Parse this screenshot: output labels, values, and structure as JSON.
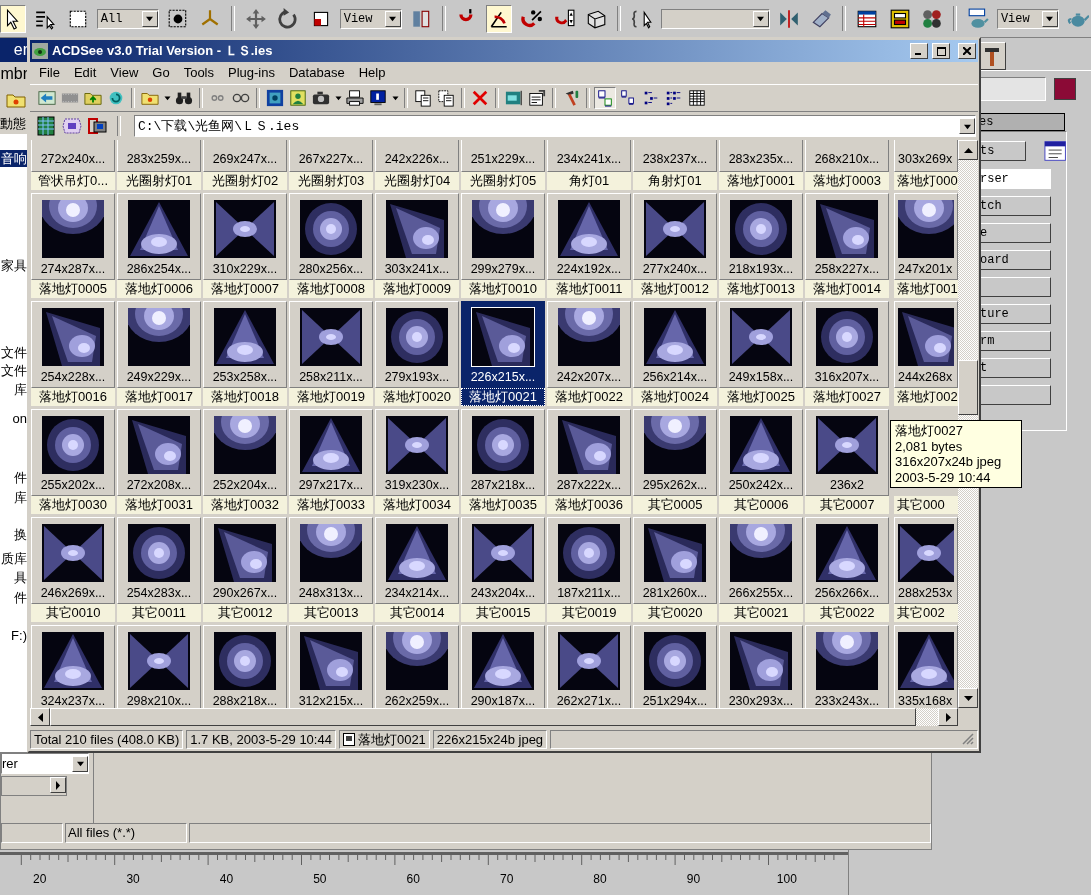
{
  "main_toolbar": {
    "items": [
      {
        "kind": "icon",
        "pressed": true
      },
      {
        "kind": "icon",
        "pressed": false
      },
      {
        "kind": "icon",
        "pressed": false
      },
      {
        "kind": "dropdown",
        "value": "All"
      },
      {
        "kind": "icon",
        "pressed": false
      },
      {
        "kind": "icon",
        "pressed": false
      },
      {
        "kind": "separator"
      },
      {
        "kind": "icon",
        "pressed": false
      },
      {
        "kind": "icon",
        "pressed": false
      },
      {
        "kind": "icon",
        "pressed": false
      },
      {
        "kind": "dropdown",
        "value": "View"
      },
      {
        "kind": "icon",
        "pressed": false
      },
      {
        "kind": "separator"
      },
      {
        "kind": "icon",
        "pressed": false
      },
      {
        "kind": "icon",
        "pressed": true
      },
      {
        "kind": "icon",
        "pressed": false
      },
      {
        "kind": "icon",
        "pressed": false
      },
      {
        "kind": "icon",
        "pressed": false
      },
      {
        "kind": "separator"
      },
      {
        "kind": "icon",
        "pressed": false
      },
      {
        "kind": "dropdown"
      },
      {
        "kind": "icon",
        "pressed": false
      },
      {
        "kind": "icon",
        "pressed": false
      },
      {
        "kind": "separator"
      },
      {
        "kind": "icon",
        "pressed": false
      },
      {
        "kind": "icon",
        "pressed": false
      },
      {
        "kind": "icon",
        "pressed": false
      },
      {
        "kind": "separator"
      },
      {
        "kind": "icon",
        "pressed": false
      },
      {
        "kind": "dropdown",
        "value": "View"
      },
      {
        "kind": "icon",
        "pressed": false
      }
    ]
  },
  "explorer": {
    "title": "er",
    "menu_text": "mbr",
    "toolbar_text": "動態",
    "tree": [
      {
        "label": "音响",
        "selected": true
      },
      {
        "label": "家具",
        "selected": false
      },
      {
        "label": "文件",
        "selected": false
      },
      {
        "label": "文件",
        "selected": false
      },
      {
        "label": "库",
        "selected": false
      },
      {
        "label": "on",
        "selected": false
      },
      {
        "label": "件",
        "selected": false
      },
      {
        "label": "库",
        "selected": false
      },
      {
        "label": "换",
        "selected": false
      },
      {
        "label": "质库",
        "selected": false
      },
      {
        "label": "具",
        "selected": false
      },
      {
        "label": "件",
        "selected": false
      },
      {
        "label": "F:)",
        "selected": false
      }
    ]
  },
  "command_panel": {
    "rollout_title": "es",
    "top_button": "ts",
    "buttons": [
      {
        "label": "rser",
        "selected": true
      },
      {
        "label": "tch",
        "selected": false
      },
      {
        "label": "e",
        "selected": false
      },
      {
        "label": "oard",
        "selected": false
      },
      {
        "selected": false
      },
      {
        "label": "ture",
        "selected": false
      },
      {
        "label": "rm",
        "selected": false
      },
      {
        "label": "t",
        "selected": false
      },
      {
        "selected": false
      }
    ]
  },
  "dialog": {
    "field_value": "rer",
    "status": "All files (*.*)"
  },
  "ruler": {
    "labels": [
      "20",
      "30",
      "40",
      "50",
      "60",
      "70",
      "80",
      "90",
      "100"
    ]
  },
  "window": {
    "title": "ACDSee v3.0 Trial Version - ＬＳ.ies",
    "menu": [
      "File",
      "Edit",
      "View",
      "Go",
      "Tools",
      "Plug-ins",
      "Database",
      "Help"
    ],
    "toolbar": [
      {
        "kind": "icon",
        "pressed": false
      },
      {
        "kind": "icon",
        "pressed": false
      },
      {
        "kind": "icon",
        "pressed": false
      },
      {
        "kind": "icon",
        "pressed": false
      },
      {
        "kind": "separator"
      },
      {
        "kind": "icon",
        "pressed": false
      },
      {
        "kind": "caret"
      },
      {
        "kind": "icon",
        "pressed": false
      },
      {
        "kind": "separator"
      },
      {
        "kind": "icon",
        "pressed": false
      },
      {
        "kind": "icon",
        "pressed": false
      },
      {
        "kind": "separator"
      },
      {
        "kind": "icon",
        "pressed": false
      },
      {
        "kind": "icon",
        "pressed": false
      },
      {
        "kind": "icon",
        "pressed": false
      },
      {
        "kind": "caret"
      },
      {
        "kind": "icon",
        "pressed": false
      },
      {
        "kind": "icon",
        "pressed": false
      },
      {
        "kind": "caret"
      },
      {
        "kind": "separator"
      },
      {
        "kind": "icon",
        "pressed": false
      },
      {
        "kind": "icon",
        "pressed": false
      },
      {
        "kind": "separator"
      },
      {
        "kind": "icon",
        "pressed": false
      },
      {
        "kind": "separator"
      },
      {
        "kind": "icon",
        "pressed": false
      },
      {
        "kind": "icon",
        "pressed": false
      },
      {
        "kind": "separator"
      },
      {
        "kind": "icon",
        "pressed": false
      },
      {
        "kind": "separator"
      },
      {
        "kind": "icon",
        "pressed": true
      },
      {
        "kind": "icon",
        "pressed": false
      },
      {
        "kind": "icon",
        "pressed": false
      },
      {
        "kind": "icon",
        "pressed": false
      },
      {
        "kind": "icon",
        "pressed": false
      }
    ],
    "address": "C:\\下载\\光鱼网\\ＬＳ.ies",
    "grid": {
      "rows": [
        {
          "kind": "cut-top",
          "cells": [
            {
              "dims": "272x240x...",
              "label": "管状吊灯0...",
              "selected": false
            },
            {
              "dims": "283x259x...",
              "label": "光圈射灯01",
              "selected": false
            },
            {
              "dims": "269x247x...",
              "label": "光圈射灯02",
              "selected": false
            },
            {
              "dims": "267x227x...",
              "label": "光圈射灯03",
              "selected": false
            },
            {
              "dims": "242x226x...",
              "label": "光圈射灯04",
              "selected": false
            },
            {
              "dims": "251x229x...",
              "label": "光圈射灯05",
              "selected": false
            },
            {
              "dims": "234x241x...",
              "label": "角灯01",
              "selected": false
            },
            {
              "dims": "238x237x...",
              "label": "角射灯01",
              "selected": false
            },
            {
              "dims": "283x235x...",
              "label": "落地灯0001",
              "selected": false
            },
            {
              "dims": "268x210x...",
              "label": "落地灯0003",
              "selected": false
            },
            {
              "dims": "303x269x",
              "label": "落地灯000",
              "selected": false
            }
          ]
        },
        {
          "kind": "full",
          "cells": [
            {
              "dims": "274x287x...",
              "label": "落地灯0005",
              "selected": false
            },
            {
              "dims": "286x254x...",
              "label": "落地灯0006",
              "selected": false
            },
            {
              "dims": "310x229x...",
              "label": "落地灯0007",
              "selected": false
            },
            {
              "dims": "280x256x...",
              "label": "落地灯0008",
              "selected": false
            },
            {
              "dims": "303x241x...",
              "label": "落地灯0009",
              "selected": false
            },
            {
              "dims": "299x279x...",
              "label": "落地灯0010",
              "selected": false
            },
            {
              "dims": "224x192x...",
              "label": "落地灯0011",
              "selected": false
            },
            {
              "dims": "277x240x...",
              "label": "落地灯0012",
              "selected": false
            },
            {
              "dims": "218x193x...",
              "label": "落地灯0013",
              "selected": false
            },
            {
              "dims": "258x227x...",
              "label": "落地灯0014",
              "selected": false
            },
            {
              "dims": "247x201x",
              "label": "落地灯001",
              "selected": false
            }
          ]
        },
        {
          "kind": "full",
          "cells": [
            {
              "dims": "254x228x...",
              "label": "落地灯0016",
              "selected": false
            },
            {
              "dims": "249x229x...",
              "label": "落地灯0017",
              "selected": false
            },
            {
              "dims": "253x258x...",
              "label": "落地灯0018",
              "selected": false
            },
            {
              "dims": "258x211x...",
              "label": "落地灯0019",
              "selected": false
            },
            {
              "dims": "279x193x...",
              "label": "落地灯0020",
              "selected": false
            },
            {
              "dims": "226x215x...",
              "label": "落地灯0021",
              "selected": true
            },
            {
              "dims": "242x207x...",
              "label": "落地灯0022",
              "selected": false
            },
            {
              "dims": "256x214x...",
              "label": "落地灯0024",
              "selected": false
            },
            {
              "dims": "249x158x...",
              "label": "落地灯0025",
              "selected": false
            },
            {
              "dims": "316x207x...",
              "label": "落地灯0027",
              "selected": false
            },
            {
              "dims": "244x268x",
              "label": "落地灯002",
              "selected": false
            }
          ]
        },
        {
          "kind": "full",
          "cells": [
            {
              "dims": "255x202x...",
              "label": "落地灯0030",
              "selected": false
            },
            {
              "dims": "272x208x...",
              "label": "落地灯0031",
              "selected": false
            },
            {
              "dims": "252x204x...",
              "label": "落地灯0032",
              "selected": false
            },
            {
              "dims": "297x217x...",
              "label": "落地灯0033",
              "selected": false
            },
            {
              "dims": "319x230x...",
              "label": "落地灯0034",
              "selected": false
            },
            {
              "dims": "287x218x...",
              "label": "落地灯0035",
              "selected": false
            },
            {
              "dims": "287x222x...",
              "label": "落地灯0036",
              "selected": false
            },
            {
              "dims": "295x262x...",
              "label": "其它0005",
              "selected": false
            },
            {
              "dims": "250x242x...",
              "label": "其它0006",
              "selected": false
            },
            {
              "dims": "236x2",
              "label": "其它0007",
              "selected": false
            },
            {
              "kind": "covered",
              "label": "其它000",
              "selected": false
            }
          ]
        },
        {
          "kind": "full",
          "cells": [
            {
              "dims": "246x269x...",
              "label": "其它0010",
              "selected": false
            },
            {
              "dims": "254x283x...",
              "label": "其它0011",
              "selected": false
            },
            {
              "dims": "290x267x...",
              "label": "其它0012",
              "selected": false
            },
            {
              "dims": "248x313x...",
              "label": "其它0013",
              "selected": false
            },
            {
              "dims": "234x214x...",
              "label": "其它0014",
              "selected": false
            },
            {
              "dims": "243x204x...",
              "label": "其它0015",
              "selected": false
            },
            {
              "dims": "187x211x...",
              "label": "其它0019",
              "selected": false
            },
            {
              "dims": "281x260x...",
              "label": "其它0020",
              "selected": false
            },
            {
              "dims": "266x255x...",
              "label": "其它0021",
              "selected": false
            },
            {
              "dims": "256x266x...",
              "label": "其它0022",
              "selected": false
            },
            {
              "dims": "288x253x",
              "label": "其它002",
              "selected": false
            }
          ]
        },
        {
          "kind": "cut-bottom",
          "cells": [
            {
              "dims": "324x237x...",
              "selected": false
            },
            {
              "dims": "298x210x...",
              "selected": false
            },
            {
              "dims": "288x218x...",
              "selected": false
            },
            {
              "dims": "312x215x...",
              "selected": false
            },
            {
              "dims": "262x259x...",
              "selected": false
            },
            {
              "dims": "290x187x...",
              "selected": false
            },
            {
              "dims": "262x271x...",
              "selected": false
            },
            {
              "dims": "251x294x...",
              "selected": false
            },
            {
              "dims": "230x293x...",
              "selected": false
            },
            {
              "dims": "233x243x...",
              "selected": false
            },
            {
              "dims": "335x168x",
              "selected": false
            }
          ]
        }
      ]
    },
    "tooltip": {
      "lines": [
        "落地灯0027",
        "2,081 bytes",
        "316x207x24b jpeg",
        "2003-5-29 10:44"
      ]
    },
    "status_bar": {
      "total": "Total 210 files (408.0 KB)",
      "file_info": "1.7 KB, 2003-5-29 10:44",
      "file_name": "落地灯0021",
      "image_info": "226x215x24b jpeg"
    }
  }
}
